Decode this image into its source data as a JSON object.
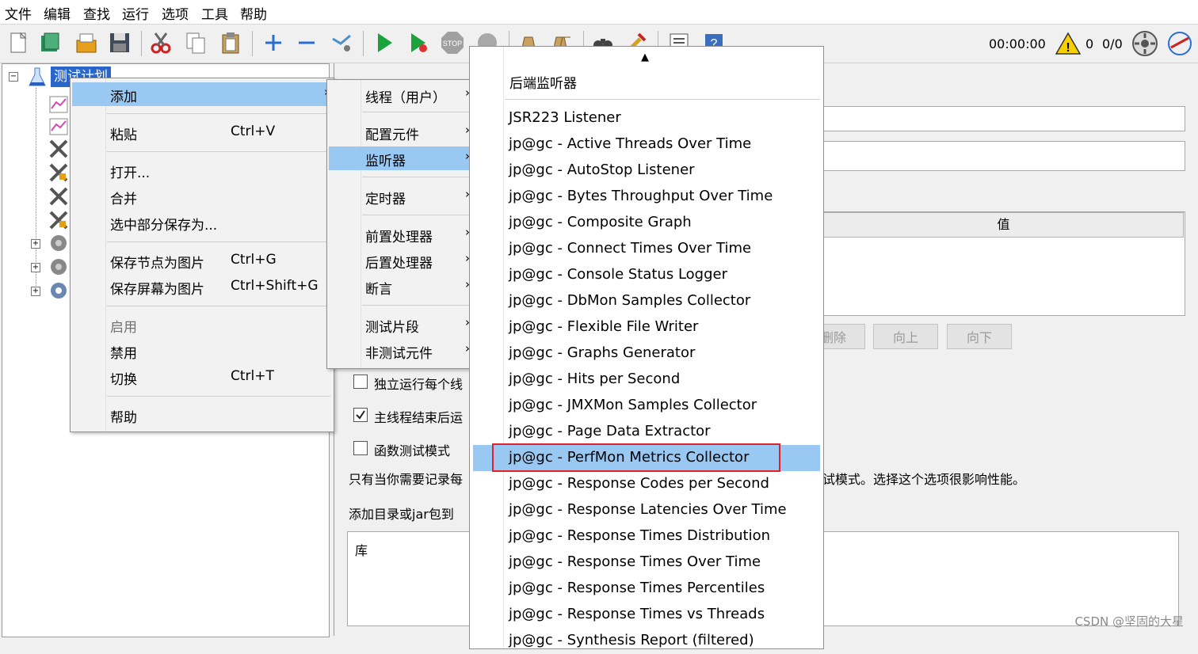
{
  "menubar": [
    "文件",
    "编辑",
    "查找",
    "运行",
    "选项",
    "工具",
    "帮助"
  ],
  "status": {
    "timer": "00:00:00",
    "warnings": "0",
    "threads": "0/0"
  },
  "tree": {
    "root_label": "测试计划"
  },
  "right": {
    "value_header": "值",
    "buttons": [
      "删除",
      "向上",
      "向下"
    ],
    "checkbox_1": "独立运行每个线",
    "checkbox_2": "主线程结束后运",
    "checkbox_3": "函数测试模式",
    "note_1": "只有当你需要记录每",
    "note_1_tail": "试模式。选择这个选项很影响性能。",
    "note_2": "添加目录或jar包到",
    "lib_header": "库"
  },
  "context_menu": [
    {
      "label": "添加",
      "shortcut": "",
      "arrow": true,
      "highlight": true
    },
    {
      "label": "粘贴",
      "shortcut": "Ctrl+V"
    },
    {
      "label": "打开...",
      "shortcut": ""
    },
    {
      "label": "合并",
      "shortcut": ""
    },
    {
      "label": "选中部分保存为...",
      "shortcut": ""
    },
    {
      "label": "保存节点为图片",
      "shortcut": "Ctrl+G"
    },
    {
      "label": "保存屏幕为图片",
      "shortcut": "Ctrl+Shift+G"
    },
    {
      "label": "启用",
      "shortcut": "",
      "disabled": true
    },
    {
      "label": "禁用",
      "shortcut": ""
    },
    {
      "label": "切换",
      "shortcut": "Ctrl+T"
    },
    {
      "label": "帮助",
      "shortcut": ""
    }
  ],
  "add_menu": [
    {
      "label": "线程（用户）"
    },
    {
      "label": "配置元件"
    },
    {
      "label": "监听器",
      "highlight": true
    },
    {
      "label": "定时器"
    },
    {
      "label": "前置处理器"
    },
    {
      "label": "后置处理器"
    },
    {
      "label": "断言"
    },
    {
      "label": "测试片段"
    },
    {
      "label": "非测试元件"
    }
  ],
  "listener_menu": {
    "scroll_up": "▲",
    "top_item": "后端监听器",
    "items": [
      "JSR223 Listener",
      "jp@gc - Active Threads Over Time",
      "jp@gc - AutoStop Listener",
      "jp@gc - Bytes Throughput Over Time",
      "jp@gc - Composite Graph",
      "jp@gc - Connect Times Over Time",
      "jp@gc - Console Status Logger",
      "jp@gc - DbMon Samples Collector",
      "jp@gc - Flexible File Writer",
      "jp@gc - Graphs Generator",
      "jp@gc - Hits per Second",
      "jp@gc - JMXMon Samples Collector",
      "jp@gc - Page Data Extractor",
      "jp@gc - PerfMon Metrics Collector",
      "jp@gc - Response Codes per Second",
      "jp@gc - Response Latencies Over Time",
      "jp@gc - Response Times Distribution",
      "jp@gc - Response Times Over Time",
      "jp@gc - Response Times Percentiles",
      "jp@gc - Response Times vs Threads",
      "jp@gc - Synthesis Report (filtered)"
    ],
    "selected_label": "jp@gc - PerfMon Metrics Collector"
  },
  "watermark": "CSDN @坚固的大星",
  "colors": {
    "highlight": "#99c9f3",
    "selection_box": "#e0202a",
    "play": "#1aa33a"
  }
}
